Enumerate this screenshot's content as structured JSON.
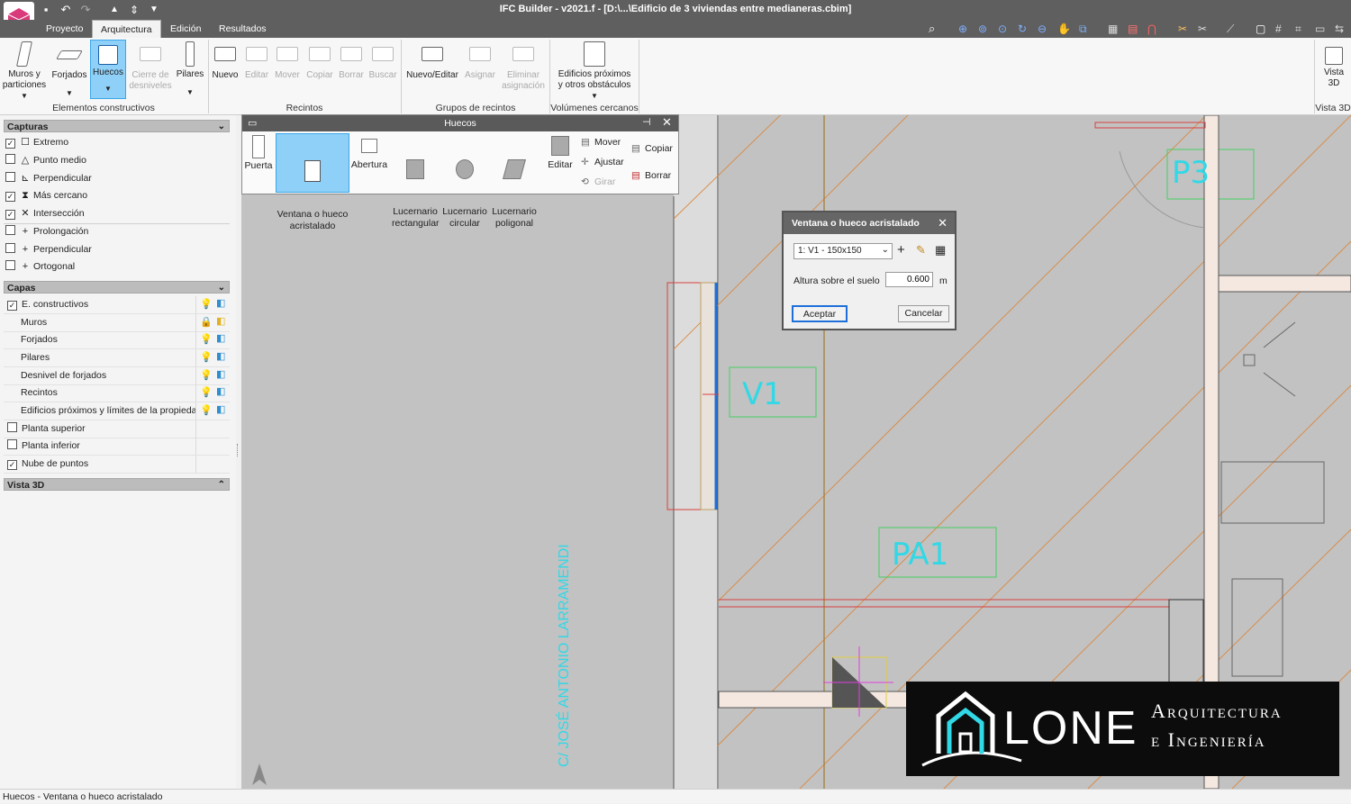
{
  "app": {
    "title": "IFC Builder - v2021.f - [D:\\...\\Edificio de 3 viviendas entre medianeras.cbim]"
  },
  "menu_tabs": [
    "Proyecto",
    "Arquitectura",
    "Edición",
    "Resultados"
  ],
  "ribbon": {
    "elementos": {
      "group_label": "Elementos constructivos",
      "buttons": [
        {
          "label": "Muros y\nparticiones",
          "icon": "wall-icon"
        },
        {
          "label": "Forjados",
          "icon": "slab-icon"
        },
        {
          "label": "Huecos",
          "icon": "opening-icon"
        },
        {
          "label": "Cierre de\ndesniveles",
          "icon": "level-closure-icon"
        },
        {
          "label": "Pilares",
          "icon": "column-icon"
        }
      ]
    },
    "recintos": {
      "group_label": "Recintos",
      "buttons": [
        "Nuevo",
        "Editar",
        "Mover",
        "Copiar",
        "Borrar",
        "Buscar"
      ]
    },
    "grupos": {
      "group_label": "Grupos de recintos",
      "buttons": [
        "Nuevo/Editar",
        "Asignar",
        "Eliminar\nasignación"
      ]
    },
    "volumenes": {
      "group_label": "Volúmenes cercanos",
      "buttons": [
        "Edificios próximos\ny otros obstáculos"
      ]
    },
    "vista3d": {
      "group_label": "Vista 3D",
      "button": "Vista\n3D"
    }
  },
  "left_panel": {
    "capturas": {
      "title": "Capturas",
      "items": [
        {
          "label": "Extremo",
          "checked": true,
          "icon": "square-snap-icon"
        },
        {
          "label": "Punto medio",
          "checked": false,
          "icon": "triangle-snap-icon"
        },
        {
          "label": "Perpendicular",
          "checked": false,
          "icon": "perpendicular-snap-icon"
        },
        {
          "label": "Más cercano",
          "checked": true,
          "icon": "nearest-snap-icon"
        },
        {
          "label": "Intersección",
          "checked": true,
          "icon": "intersection-snap-icon"
        },
        {
          "label": "Prolongación",
          "checked": false,
          "icon": "plus-snap-icon"
        },
        {
          "label": "Perpendicular",
          "checked": false,
          "icon": "plus-snap-icon"
        },
        {
          "label": "Ortogonal",
          "checked": false,
          "icon": "plus-snap-icon"
        }
      ]
    },
    "capas": {
      "title": "Capas",
      "items": [
        {
          "label": "E. constructivos",
          "checkbox": true,
          "checked": true,
          "icons": true
        },
        {
          "label": "Muros",
          "checkbox": false,
          "icons": true,
          "locked": true
        },
        {
          "label": "Forjados",
          "checkbox": false,
          "icons": true
        },
        {
          "label": "Pilares",
          "checkbox": false,
          "icons": true
        },
        {
          "label": "Desnivel de forjados",
          "checkbox": false,
          "icons": true
        },
        {
          "label": "Recintos",
          "checkbox": false,
          "icons": true
        },
        {
          "label": "Edificios próximos y límites de la propiedad",
          "checkbox": false,
          "icons": true
        },
        {
          "label": "Planta superior",
          "checkbox": true,
          "checked": false,
          "icons": false
        },
        {
          "label": "Planta inferior",
          "checkbox": true,
          "checked": false,
          "icons": false
        },
        {
          "label": "Nube de puntos",
          "checkbox": true,
          "checked": true,
          "icons": false
        }
      ]
    },
    "vista3d": {
      "title": "Vista 3D"
    }
  },
  "huecos_toolbar": {
    "title": "Huecos",
    "buttons": [
      {
        "label": "Puerta"
      },
      {
        "label": "Ventana o hueco\nacristalado"
      },
      {
        "label": "Abertura"
      },
      {
        "label": "Lucernario\nrectangular"
      },
      {
        "label": "Lucernario\ncircular"
      },
      {
        "label": "Lucernario\npoligonal"
      },
      {
        "label": "Editar"
      }
    ],
    "small": {
      "mover": "Mover",
      "ajustar": "Ajustar",
      "girar": "Girar",
      "copiar": "Copiar",
      "borrar": "Borrar"
    }
  },
  "dialog": {
    "title": "Ventana o hueco acristalado",
    "select_value": "1: V1 - 150x150",
    "height_label": "Altura sobre el suelo",
    "height_value": "0.600",
    "unit": "m",
    "accept": "Aceptar",
    "cancel": "Cancelar"
  },
  "drawing": {
    "labels": {
      "p3": "P3",
      "v1": "V1",
      "pa1": "PA1"
    },
    "street": "C/ JOSÉ ANTONIO LARRAMENDI"
  },
  "logo": {
    "name": "LONE",
    "line1": "Arquitectura",
    "line2": "e Ingeniería"
  },
  "status": "Huecos - Ventana o hueco acristalado",
  "colors": {
    "accent": "#3aa6e8",
    "selected_bg": "#8fd0f8",
    "label_cyan": "#31d8e6",
    "wall_red": "#d94040",
    "wall_fill": "#f4e8e0"
  }
}
